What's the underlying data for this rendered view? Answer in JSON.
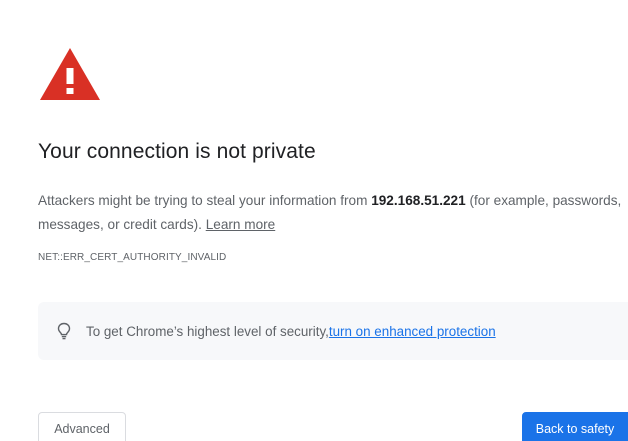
{
  "interstitial": {
    "icon": "warning-triangle-icon",
    "icon_color": "#d93025",
    "title": "Your connection is not private",
    "body_prefix": "Attackers might be trying to steal your information from ",
    "host": "192.168.51.221",
    "body_suffix": " (for example, passwords, messages, or credit cards). ",
    "learn_more": "Learn more",
    "error_code": "NET::ERR_CERT_AUTHORITY_INVALID"
  },
  "banner": {
    "icon": "lightbulb-icon",
    "text": "To get Chrome’s highest level of security, ",
    "link": "turn on enhanced protection",
    "link_color": "#1a73e8"
  },
  "buttons": {
    "advanced": "Advanced",
    "back_to_safety": "Back to safety",
    "primary_color": "#1a73e8"
  }
}
